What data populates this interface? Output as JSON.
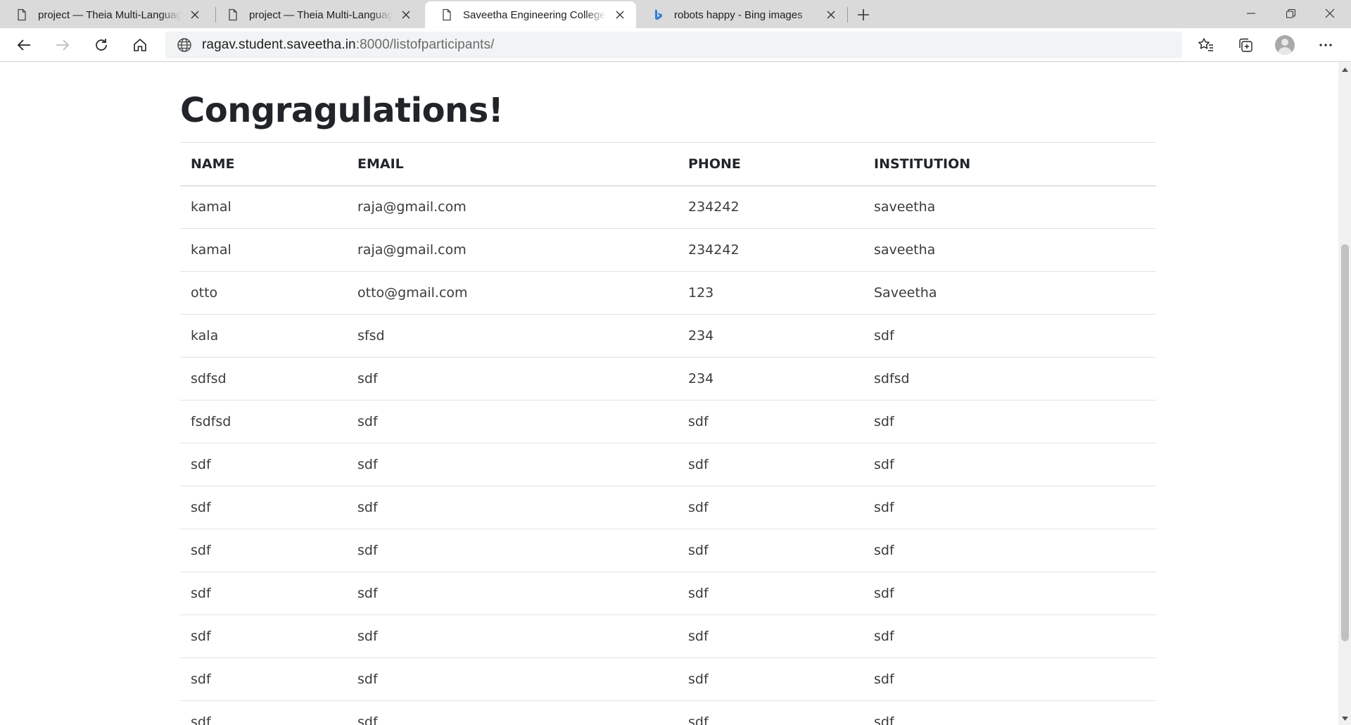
{
  "browser": {
    "tabs": [
      {
        "title": "project — Theia Multi-Language",
        "icon": "page-icon",
        "active": false
      },
      {
        "title": "project — Theia Multi-Language",
        "icon": "page-icon",
        "active": false
      },
      {
        "title": "Saveetha Engineering College",
        "icon": "page-icon",
        "active": true
      },
      {
        "title": "robots happy - Bing images",
        "icon": "bing-icon",
        "active": false
      }
    ],
    "address": {
      "host": "ragav.student.saveetha.in",
      "rest": ":8000/listofparticipants/"
    }
  },
  "page": {
    "heading": "Congragulations!",
    "table": {
      "headers": [
        "NAME",
        "EMAIL",
        "PHONE",
        "INSTITUTION"
      ],
      "rows": [
        [
          "kamal",
          "raja@gmail.com",
          "234242",
          "saveetha"
        ],
        [
          "kamal",
          "raja@gmail.com",
          "234242",
          "saveetha"
        ],
        [
          "otto",
          "otto@gmail.com",
          "123",
          "Saveetha"
        ],
        [
          "kala",
          "sfsd",
          "234",
          "sdf"
        ],
        [
          "sdfsd",
          "sdf",
          "234",
          "sdfsd"
        ],
        [
          "fsdfsd",
          "sdf",
          "sdf",
          "sdf"
        ],
        [
          "sdf",
          "sdf",
          "sdf",
          "sdf"
        ],
        [
          "sdf",
          "sdf",
          "sdf",
          "sdf"
        ],
        [
          "sdf",
          "sdf",
          "sdf",
          "sdf"
        ],
        [
          "sdf",
          "sdf",
          "sdf",
          "sdf"
        ],
        [
          "sdf",
          "sdf",
          "sdf",
          "sdf"
        ],
        [
          "sdf",
          "sdf",
          "sdf",
          "sdf"
        ],
        [
          "sdf",
          "sdf",
          "sdf",
          "sdf"
        ]
      ]
    }
  }
}
